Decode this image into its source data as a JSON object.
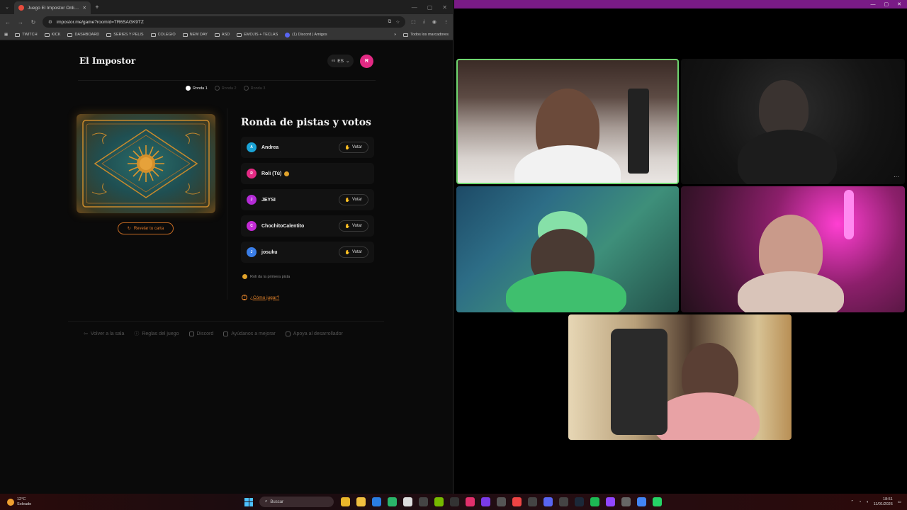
{
  "browser": {
    "tab_title": "Juego El Impostor Online - Jueg",
    "new_tab": "+",
    "url": "impostor.me/game?roomId=TR6SAGK9TZ",
    "bookmarks": [
      "TWITCH",
      "KICK",
      "DASHBOARD",
      "SERIES Y PELIS",
      "COLEGIO",
      "NEW DAY",
      "ASD",
      "EMOJIS + TECLAS",
      "(1) Discord | Amigos"
    ],
    "bookmarks_overflow": "»",
    "all_bookmarks": "Todos los marcadores"
  },
  "page": {
    "brand": "El Impostor",
    "lang": "ES",
    "lang_flag": "es",
    "user_initial": "R",
    "steps": [
      {
        "label": "Ronda 1",
        "active": true
      },
      {
        "label": "Ronda 2",
        "active": false
      },
      {
        "label": "Ronda 3",
        "active": false
      }
    ],
    "reveal_button": "Revelar tu carta",
    "round_title": "Ronda de pistas y votos",
    "players": [
      {
        "initial": "A",
        "name": "Andrea",
        "color": "#1aa3d6",
        "vote": "Votar",
        "coin": false
      },
      {
        "initial": "R",
        "name": "Roli (Tú)",
        "color": "#e32a84",
        "vote": "",
        "coin": true
      },
      {
        "initial": "J",
        "name": "JEYSI",
        "color": "#b42bd6",
        "vote": "Votar",
        "coin": false
      },
      {
        "initial": "C",
        "name": "ChochitoCalentito",
        "color": "#c42ad6",
        "vote": "Votar",
        "coin": false
      },
      {
        "initial": "J",
        "name": "josuku",
        "color": "#3a7ee8",
        "vote": "Votar",
        "coin": false
      }
    ],
    "hint": "Roli da la primera pista",
    "howto": "¿Cómo jugar?",
    "footer": [
      "Volver a la sala",
      "Reglas del juego",
      "Discord",
      "Ayúdanos a mejorar",
      "Apoya al desarrollador"
    ]
  },
  "call": {
    "tile_more": "···"
  },
  "taskbar": {
    "temp": "12°C",
    "weather": "Soleado",
    "search_placeholder": "Buscar",
    "time": "18:51",
    "date": "11/01/2026"
  }
}
